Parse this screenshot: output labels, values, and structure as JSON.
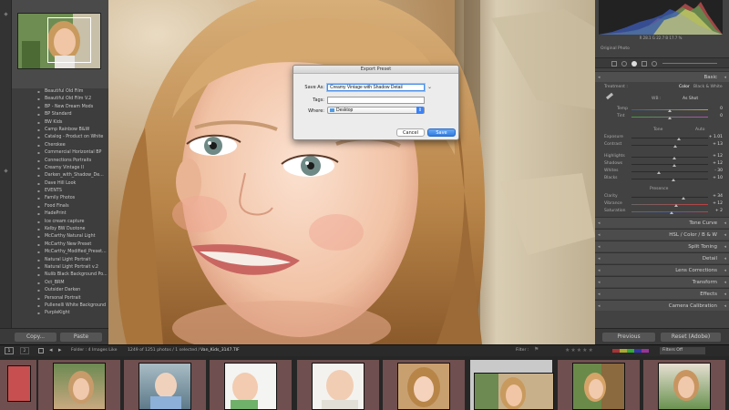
{
  "left_panel": {
    "presets": [
      "Beautiful Old Film",
      "Beautiful Old Film V.2",
      "BP - New Dream Mods",
      "BP Standard",
      "BW Kids",
      "Camp Rainbow B&W",
      "Catalog - Product on White",
      "Cherokee",
      "Commercial Horizontal BP",
      "Connections Portraits",
      "Creamy Vintage II",
      "Darken_with_Shadow_De...",
      "Dave Hill Look",
      "EVENTS",
      "Family Photos",
      "Food Finals",
      "HadePrint",
      "Ice cream capture",
      "Kelby BW Duotone",
      "McCarthy Natural Light",
      "McCarthy New Preset",
      "McCarthy_Modified_Preset...",
      "Natural Light Portrait",
      "Natural Light Portrait v.2",
      "Nulib Black Background Po...",
      "Oct_BRM",
      "Outsider Darken",
      "Personal Portrait",
      "Pullenelli White Background",
      "PurpleKight"
    ],
    "copy_label": "Copy...",
    "paste_label": "Paste"
  },
  "dialog": {
    "title": "Export Preset",
    "save_as_label": "Save As:",
    "save_as_value": "Creamy Vintage with Shadow Detail",
    "tags_label": "Tags:",
    "tags_value": "",
    "where_label": "Where:",
    "where_value": "Desktop",
    "cancel_label": "Cancel",
    "save_label": "Save"
  },
  "right_panel": {
    "histogram_readout": "R 28.1  G 22.7  B 17.7 %",
    "original_photo_label": "Original Photo",
    "basic_header": "Basic",
    "treatment_label": "Treatment :",
    "treatment_color": "Color",
    "treatment_bw": "Black & White",
    "wb_label": "WB :",
    "wb_value": "As Shot",
    "temp_label": "Temp",
    "temp_value": "0",
    "tint_label": "Tint",
    "tint_value": "0",
    "tone_label": "Tone",
    "auto_label": "Auto",
    "exposure_label": "Exposure",
    "exposure_value": "+ 1.01",
    "contrast_label": "Contrast",
    "contrast_value": "+ 13",
    "highlights_label": "Highlights",
    "highlights_value": "+ 12",
    "shadows_label": "Shadows",
    "shadows_value": "+ 12",
    "whites_label": "Whites",
    "whites_value": "- 30",
    "blacks_label": "Blacks",
    "blacks_value": "+ 10",
    "presence_label": "Presence",
    "clarity_label": "Clarity",
    "clarity_value": "+ 34",
    "vibrance_label": "Vibrance",
    "vibrance_value": "+ 12",
    "saturation_label": "Saturation",
    "saturation_value": "+ 2",
    "sections": [
      "Tone Curve",
      "HSL / Color / B & W",
      "Split Toning",
      "Detail",
      "Lens Corrections",
      "Transform",
      "Effects",
      "Camera Calibration"
    ],
    "previous_label": "Previous",
    "reset_label": "Reset (Adobe)"
  },
  "film_toolbar": {
    "page1": "1",
    "page2": "2",
    "source_text": "Folder : 4 Images Like",
    "count_text": "1249 of 1251 photos / 1 selected /",
    "filename": "Van_Kids_3147.TIF",
    "filter_label": "Filter :",
    "filter_value": "Filters Off"
  },
  "colors": {
    "accent_blue": "#3b82f6",
    "panel_dark": "#424242",
    "highlight_cell": "#c9c9c9"
  }
}
